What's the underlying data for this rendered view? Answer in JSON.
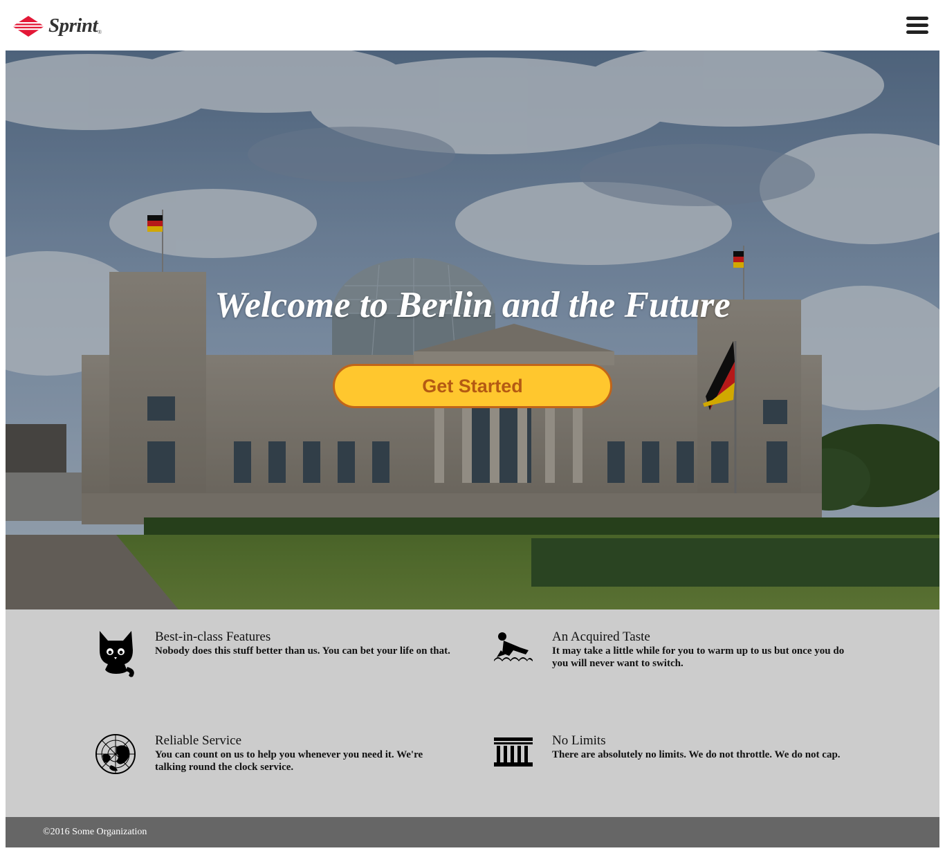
{
  "brand": {
    "name": "Sprint",
    "accent_color": "#e31837"
  },
  "header": {
    "menu_icon": "hamburger-menu-icon"
  },
  "hero": {
    "title": "Welcome to Berlin and the Future",
    "cta_label": "Get Started",
    "cta_color": "#ffc72e",
    "cta_border_color": "#c0651a"
  },
  "features": [
    {
      "icon": "cat-icon",
      "title": "Best-in-class Features",
      "text": "Nobody does this stuff better than us. You can bet your life on that."
    },
    {
      "icon": "swimmer-icon",
      "title": "An Acquired Taste",
      "text": "It may take a little while for you to warm up to us but once you do you will never want to switch."
    },
    {
      "icon": "globe-map-icon",
      "title": "Reliable Service",
      "text": "You can count on us to help you whenever you need it. We're talking round the clock service."
    },
    {
      "icon": "columns-building-icon",
      "title": "No Limits",
      "text": "There are absolutely no limits. We do not throttle. We do not cap."
    }
  ],
  "footer": {
    "text": "©2016 Some Organization"
  }
}
